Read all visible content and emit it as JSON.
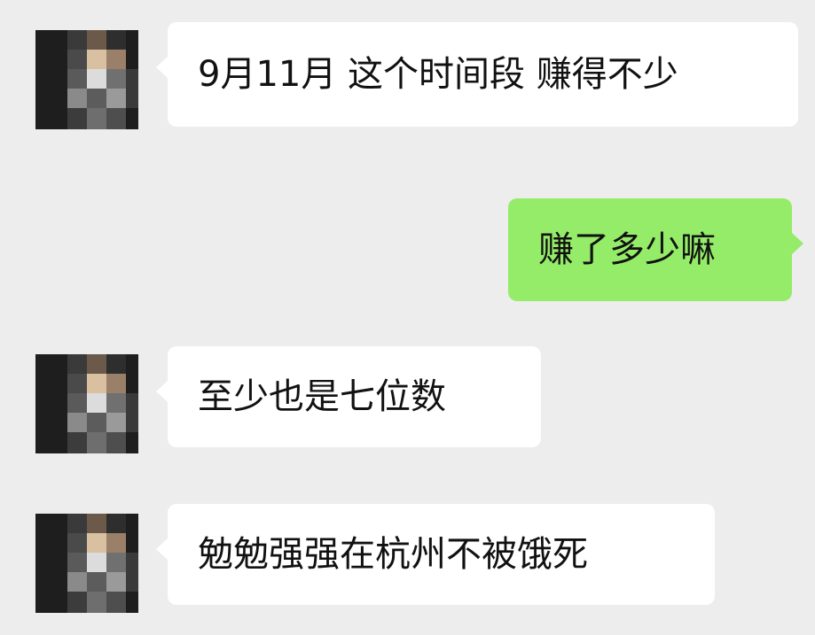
{
  "messages": [
    {
      "sender": "contact",
      "text": "9月11月 这个时间段 赚得不少"
    },
    {
      "sender": "me",
      "text": "赚了多少嘛"
    },
    {
      "sender": "contact",
      "text": "至少也是七位数"
    },
    {
      "sender": "contact",
      "text": "勉勉强强在杭州不被饿死"
    }
  ],
  "colors": {
    "background": "#ededed",
    "incoming_bubble": "#ffffff",
    "outgoing_bubble": "#95ec69"
  },
  "avatar": {
    "style": "pixelated-mosaic"
  }
}
